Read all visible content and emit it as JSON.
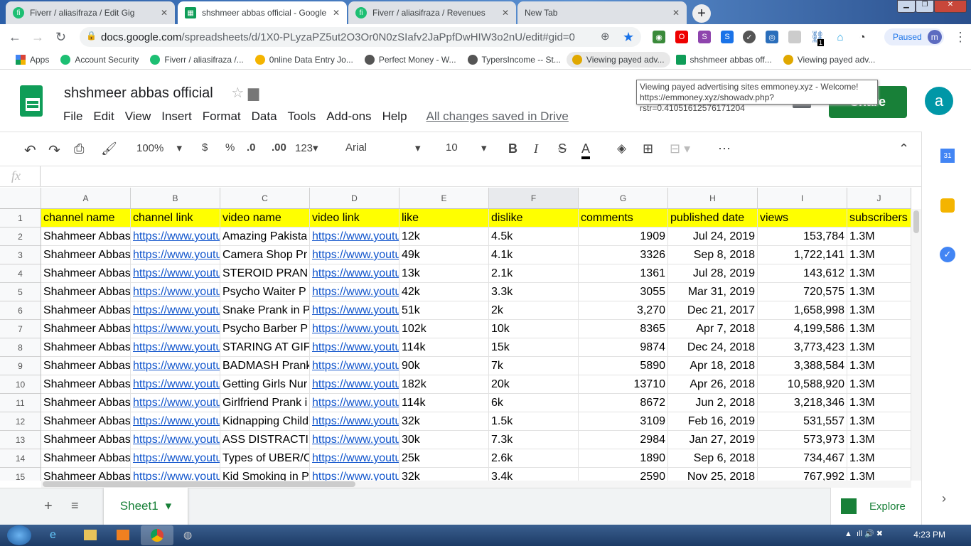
{
  "browser": {
    "tabs": [
      {
        "title": "Fiverr / aliasifraza / Edit Gig",
        "icon": "fiverr"
      },
      {
        "title": "shshmeer abbas official - Google",
        "icon": "sheets",
        "active": true
      },
      {
        "title": "Fiverr / aliasifraza / Revenues",
        "icon": "fiverr"
      },
      {
        "title": "New Tab",
        "icon": ""
      }
    ],
    "url_host": "docs.google.com",
    "url_path": "/spreadsheets/d/1X0-PLyzaPZ5ut2O3Or0N0zSIafv2JaPpfDwHIW3o2nU/edit#gid=0",
    "paused_label": "Paused",
    "profile_initial": "m",
    "extension_badge": "1",
    "bookmarks": [
      {
        "label": "Apps"
      },
      {
        "label": "Account Security"
      },
      {
        "label": "Fiverr / aliasifraza /..."
      },
      {
        "label": "0nline Data Entry Jo..."
      },
      {
        "label": "Perfect Money - W..."
      },
      {
        "label": "TypersIncome -- St..."
      },
      {
        "label": "Viewing payed adv..."
      },
      {
        "label": "shshmeer abbas off..."
      },
      {
        "label": "Viewing payed adv..."
      }
    ],
    "tooltip_line1": "Viewing payed advertising sites emmoney.xyz - Welcome!",
    "tooltip_line2": "https://emmoney.xyz/showadv.php?rstr=0.41051612576171204"
  },
  "doc": {
    "title": "shshmeer abbas official",
    "menu": [
      "File",
      "Edit",
      "View",
      "Insert",
      "Format",
      "Data",
      "Tools",
      "Add-ons",
      "Help"
    ],
    "saved_status": "All changes saved in Drive",
    "share_label": "Share",
    "account_initial": "a"
  },
  "toolbar": {
    "zoom": "100%",
    "currency": "$",
    "percent": "%",
    "dec_less": ".0",
    "dec_more": ".00",
    "format_more": "123",
    "font": "Arial",
    "font_size": "10"
  },
  "formula_bar": {
    "fx": "fx",
    "value": ""
  },
  "grid": {
    "columns": [
      "A",
      "B",
      "C",
      "D",
      "E",
      "F",
      "G",
      "H",
      "I",
      "J"
    ],
    "header_row": [
      "channel name",
      "channel link",
      "video name",
      "video link",
      "like",
      "dislike",
      "comments",
      "published date",
      "views",
      "subscribers"
    ],
    "rows": [
      [
        "Shahmeer Abbas",
        "https://www.youtu",
        "Amazing Pakista",
        "https://www.youtu",
        "12k",
        "4.5k",
        "1909",
        "Jul 24, 2019",
        "153,784",
        "1.3M"
      ],
      [
        "Shahmeer Abbas",
        "https://www.youtu",
        "Camera Shop Pr",
        "https://www.youtu",
        "49k",
        "4.1k",
        "3326",
        "Sep 8, 2018",
        "1,722,141",
        "1.3M"
      ],
      [
        "Shahmeer Abbas",
        "https://www.youtu",
        "STEROID PRAN",
        "https://www.youtu",
        "13k",
        "2.1k",
        "1361",
        "Jul 28, 2019",
        "143,612",
        "1.3M"
      ],
      [
        "Shahmeer Abbas",
        "https://www.youtu",
        "Psycho Waiter P",
        "https://www.youtu",
        "42k",
        "3.3k",
        "3055",
        "Mar 31, 2019",
        "720,575",
        "1.3M"
      ],
      [
        "Shahmeer Abbas",
        "https://www.youtu",
        "Snake Prank in P",
        "https://www.youtu",
        "51k",
        "2k",
        "3,270",
        "Dec 21, 2017",
        "1,658,998",
        "1.3M"
      ],
      [
        "Shahmeer Abbas",
        "https://www.youtu",
        "Psycho Barber P",
        "https://www.youtu",
        "102k",
        "10k",
        "8365",
        "Apr 7, 2018",
        "4,199,586",
        "1.3M"
      ],
      [
        "Shahmeer Abbas",
        "https://www.youtu",
        "STARING AT GIF",
        "https://www.youtu",
        "114k",
        "15k",
        "9874",
        "Dec 24, 2018",
        "3,773,423",
        "1.3M"
      ],
      [
        "Shahmeer Abbas",
        "https://www.youtu",
        "BADMASH Prank",
        "https://www.youtu",
        "90k",
        "7k",
        "5890",
        "Apr 18, 2018",
        "3,388,584",
        "1.3M"
      ],
      [
        "Shahmeer Abbas",
        "https://www.youtu",
        "Getting Girls Nur",
        "https://www.youtu",
        "182k",
        "20k",
        "13710",
        "Apr 26, 2018",
        "10,588,920",
        "1.3M"
      ],
      [
        "Shahmeer Abbas",
        "https://www.youtu",
        "Girlfriend Prank i",
        "https://www.youtu",
        "114k",
        "6k",
        "8672",
        "Jun 2, 2018",
        "3,218,346",
        "1.3M"
      ],
      [
        "Shahmeer Abbas",
        "https://www.youtu",
        "Kidnapping Child",
        "https://www.youtu",
        "32k",
        "1.5k",
        "3109",
        "Feb 16, 2019",
        "531,557",
        "1.3M"
      ],
      [
        "Shahmeer Abbas",
        "https://www.youtu",
        "ASS DISTRACTI",
        "https://www.youtu",
        "30k",
        "7.3k",
        "2984",
        "Jan 27, 2019",
        "573,973",
        "1.3M"
      ],
      [
        "Shahmeer Abbas",
        "https://www.youtu",
        "Types of UBER/C",
        "https://www.youtu",
        "25k",
        "2.6k",
        "1890",
        "Sep 6, 2018",
        "734,467",
        "1.3M"
      ],
      [
        "Shahmeer Abbas",
        "https://www.youtu",
        "Kid Smoking in P",
        "https://www.youtu",
        "32k",
        "3.4k",
        "2590",
        "Nov 25, 2018",
        "767,992",
        "1.3M"
      ]
    ],
    "header_color": "#ffff00",
    "link_color": "#1155cc"
  },
  "sheets": {
    "active": "Sheet1",
    "explore_label": "Explore"
  },
  "taskbar": {
    "time": "4:23 PM"
  }
}
